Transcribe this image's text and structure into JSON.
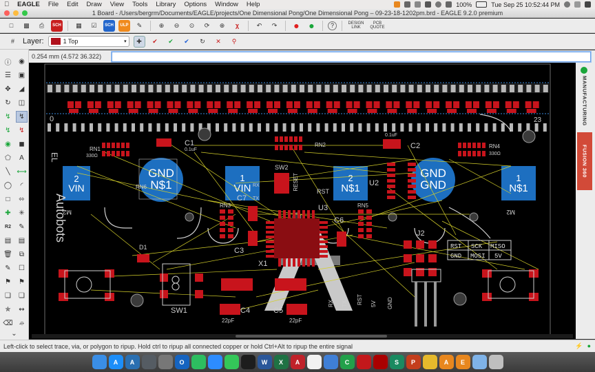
{
  "menubar": {
    "app_name": "EAGLE",
    "items": [
      "File",
      "Edit",
      "Draw",
      "View",
      "Tools",
      "Library",
      "Options",
      "Window",
      "Help"
    ],
    "battery": "100%",
    "clock": "Tue Sep 25  10:52:44 PM"
  },
  "titlebar": {
    "title": "1 Board - /Users/bergrm/Documents/EAGLE/projects/One Dimensional Pong/One Dimensional Pong – 09-23-18-1202pm.brd - EAGLE 9.2.0 premium"
  },
  "toolbar": {
    "sch_label": "SCH",
    "ulp_label": "ULP",
    "design_link_label": "DESIGN LINK",
    "pcb_quote_label": "PCB QUOTE",
    "help_label": "?"
  },
  "layerbar": {
    "label": "Layer:",
    "selected_layer": "1 Top",
    "layer_color": "#b0101c"
  },
  "cmdbar": {
    "coordinates": "0.254 mm (4.572 36.322)",
    "command_value": ""
  },
  "canvas": {
    "ruler_left": "0",
    "ruler_right": "23",
    "components": {
      "left_vin": {
        "num": "2",
        "text": "VIN"
      },
      "left_gnd": {
        "line1": "GND",
        "line2": "N$1"
      },
      "mid_vin": {
        "num": "1",
        "text": "VIN"
      },
      "mid_n1": {
        "num": "2",
        "text": "N$1"
      },
      "right_gnd": {
        "line1": "GND",
        "line2": "GND"
      },
      "right_n1": {
        "num": "1",
        "text": "N$1"
      }
    },
    "labels": {
      "c1": "C1",
      "c1_val": "0.1uF",
      "c2": "C2",
      "c2_val": "0.1uF",
      "c3": "C3",
      "c4": "C4",
      "c4_val": "22pF",
      "c5": "C5",
      "c5_val": "22pF",
      "c6": "C6",
      "c7": "C7",
      "u2": "U2",
      "u3": "U3",
      "x1": "X1",
      "sw1": "SW1",
      "sw2": "SW2",
      "reset": "RESET",
      "d1": "D1",
      "j2": "J2",
      "rn1": "RN1",
      "rn1_val": "330Ω",
      "rn2": "RN2",
      "rn3": "RN3",
      "rn4": "RN4",
      "rn4_val": "330Ω",
      "rn5": "RN5",
      "rn6": "RN6",
      "rst": "RST",
      "rx": "RX",
      "tx": "TX",
      "r5v": "5V",
      "gnd_v": "GND",
      "rst_v": "RST",
      "rx_v": "RX",
      "tx_v": "TX",
      "author": "Autobots",
      "vs1": "EL",
      "vs2": "MISSION",
      "m1": "M2",
      "m2": "M2",
      "header_cells": [
        "RST",
        "SCK",
        "MISO",
        "GND",
        "MOSI",
        "5V"
      ]
    }
  },
  "rightbar": {
    "manufacturing_label": "MANUFACTURING",
    "fusion_label": "FUSION 360"
  },
  "statusbar": {
    "message": "Left-click to select trace, via, or polygon to ripup. Hold ctrl to ripup all connected copper or hold Ctrl+Alt to ripup the entire signal"
  },
  "dock": {
    "apps": [
      {
        "name": "finder",
        "letter": "",
        "color": "#3a8ee6"
      },
      {
        "name": "app-store",
        "letter": "A",
        "color": "#1c8ef9"
      },
      {
        "name": "autodesk",
        "letter": "A",
        "color": "#2a6fb1"
      },
      {
        "name": "time-machine",
        "letter": "",
        "color": "#555c63"
      },
      {
        "name": "clock",
        "letter": "",
        "color": "#777"
      },
      {
        "name": "outlook",
        "letter": "O",
        "color": "#1664c0"
      },
      {
        "name": "evernote",
        "letter": "",
        "color": "#2dbe60"
      },
      {
        "name": "zoom",
        "letter": "",
        "color": "#2d8cff"
      },
      {
        "name": "messages",
        "letter": "",
        "color": "#34c759"
      },
      {
        "name": "facetime",
        "letter": "",
        "color": "#1d1d1d"
      },
      {
        "name": "word",
        "letter": "W",
        "color": "#2b579a"
      },
      {
        "name": "excel",
        "letter": "X",
        "color": "#1f7244"
      },
      {
        "name": "autocad",
        "letter": "A",
        "color": "#c0222a"
      },
      {
        "name": "photos",
        "letter": "",
        "color": "#f2f2f2"
      },
      {
        "name": "photo-app",
        "letter": "",
        "color": "#3f7fd6"
      },
      {
        "name": "c-app",
        "letter": "C",
        "color": "#22a04a"
      },
      {
        "name": "acrobat",
        "letter": "",
        "color": "#c3181b"
      },
      {
        "name": "acrobat-reader",
        "letter": "",
        "color": "#a00"
      },
      {
        "name": "sketch",
        "letter": "S",
        "color": "#1a8a60"
      },
      {
        "name": "powerpoint",
        "letter": "P",
        "color": "#c43e1c"
      },
      {
        "name": "chrome",
        "letter": "",
        "color": "#e5b92c"
      },
      {
        "name": "fusion",
        "letter": "A",
        "color": "#e8871e"
      },
      {
        "name": "eagle",
        "letter": "E",
        "color": "#e8871e"
      },
      {
        "name": "downloads",
        "letter": "",
        "color": "#7fb3e8"
      },
      {
        "name": "trash",
        "letter": "",
        "color": "#bfbfbf"
      }
    ]
  }
}
